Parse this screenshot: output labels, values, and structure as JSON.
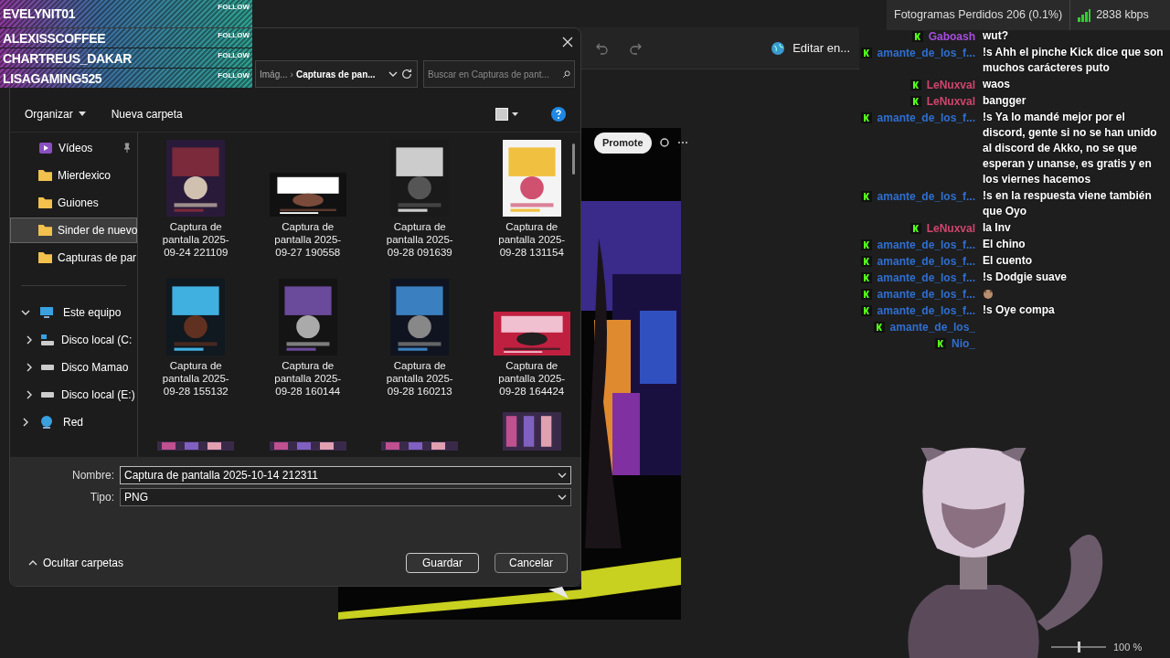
{
  "follow_alerts": [
    {
      "name": "EVELYNIT01",
      "action": "FOLLOW"
    },
    {
      "name": "ALEXISSCOFFEE",
      "action": "FOLLOW"
    },
    {
      "name": "CHARTREUS_DAKAR",
      "action": "FOLLOW"
    },
    {
      "name": "LISAGAMING525",
      "action": "FOLLOW"
    }
  ],
  "editor_toolbar": {
    "edit_label": "Editar en..."
  },
  "preview": {
    "promote": "Promote"
  },
  "stats": {
    "dropped_frames": "Fotogramas Perdidos 206 (0.1%)",
    "bitrate": "2838 kbps"
  },
  "dialog": {
    "breadcrumb": [
      "Imág...",
      "Capturas de pan..."
    ],
    "breadcrumb_separator": "›",
    "search": {
      "placeholder": "Buscar en Capturas de pant..."
    },
    "toolbar": {
      "organize": "Organizar",
      "new_folder": "Nueva carpeta"
    },
    "sidebar": [
      {
        "label": "Vídeos",
        "kind": "video",
        "pinned": true,
        "selected": false
      },
      {
        "label": "Mierdexico",
        "kind": "folder",
        "pinned": false,
        "selected": false
      },
      {
        "label": "Guiones",
        "kind": "folder",
        "pinned": false,
        "selected": false
      },
      {
        "label": "Sinder de nuevo",
        "kind": "folder",
        "pinned": false,
        "selected": true
      },
      {
        "label": "Capturas de par",
        "kind": "folder",
        "pinned": false,
        "selected": false
      }
    ],
    "tree": [
      {
        "label": "Este equipo",
        "kind": "pc",
        "expanded": true,
        "children": [
          {
            "label": "Disco local (C:",
            "kind": "drive-os",
            "expanded": false
          },
          {
            "label": "Disco Mamao",
            "kind": "drive",
            "expanded": false
          },
          {
            "label": "Disco local (E:)",
            "kind": "drive",
            "expanded": false
          }
        ]
      },
      {
        "label": "Red",
        "kind": "network",
        "expanded": false
      }
    ],
    "files": [
      {
        "name": "Captura de pantalla 2025-09-24 221109",
        "kind": "picture"
      },
      {
        "name": "Captura de pantalla 2025-09-27 190558",
        "kind": "picture"
      },
      {
        "name": "Captura de pantalla 2025-09-28 091639",
        "kind": "picture"
      },
      {
        "name": "Captura de pantalla 2025-09-28 131154",
        "kind": "picture"
      },
      {
        "name": "Captura de pantalla 2025-09-28 155132",
        "kind": "picture"
      },
      {
        "name": "Captura de pantalla 2025-09-28 160144",
        "kind": "picture"
      },
      {
        "name": "Captura de pantalla 2025-09-28 160213",
        "kind": "picture"
      },
      {
        "name": "Captura de pantalla 2025-09-28 164424",
        "kind": "picture"
      }
    ],
    "filename_label": "Nombre:",
    "filename": "Captura de pantalla 2025-10-14 212311",
    "type_label": "Tipo:",
    "type": "PNG",
    "hide_folders": "Ocultar carpetas",
    "buttons": [
      "Guardar",
      "Cancelar"
    ]
  },
  "chat": [
    {
      "user": "Gaboash",
      "color": "#a64ee0",
      "kind": "text",
      "text": "wut?"
    },
    {
      "user": "amante_de_los_f...",
      "color": "#2f6fd0",
      "kind": "text",
      "text": "!s Ahh el pinche Kick dice que son muchos carácteres puto"
    },
    {
      "user": "LeNuxval",
      "color": "#d0456e",
      "kind": "text",
      "text": "waos"
    },
    {
      "user": "LeNuxval",
      "color": "#d0456e",
      "kind": "text",
      "text": "bangger"
    },
    {
      "user": "amante_de_los_f...",
      "color": "#2f6fd0",
      "kind": "text",
      "text": "!s Ya lo mandé mejor por el discord, gente si no se han unido al discord de Akko, no se que esperan y unanse, es gratis y en los viernes hacemos"
    },
    {
      "user": "amante_de_los_f...",
      "color": "#2f6fd0",
      "kind": "text",
      "text": "!s en la respuesta viene también que Oyo"
    },
    {
      "user": "LeNuxval",
      "color": "#d0456e",
      "kind": "text",
      "text": "la Inv"
    },
    {
      "user": "amante_de_los_f...",
      "color": "#2f6fd0",
      "kind": "text",
      "text": "El chino"
    },
    {
      "user": "amante_de_los_f...",
      "color": "#2f6fd0",
      "kind": "text",
      "text": "El cuento"
    },
    {
      "user": "amante_de_los_f...",
      "color": "#2f6fd0",
      "kind": "text",
      "text": "!s Dodgie suave"
    },
    {
      "user": "amante_de_los_f...",
      "color": "#2f6fd0",
      "kind": "emote"
    },
    {
      "user": "amante_de_los_f...",
      "color": "#2f6fd0",
      "kind": "text",
      "text": "!s Oye compa"
    },
    {
      "user": "amante_de_los_",
      "color": "#2f6fd0",
      "kind": "text"
    },
    {
      "user": "Nio_",
      "color": "#2f6fd0",
      "kind": "text"
    }
  ],
  "zoom": {
    "reading": "100 %",
    "level": 0.5
  }
}
